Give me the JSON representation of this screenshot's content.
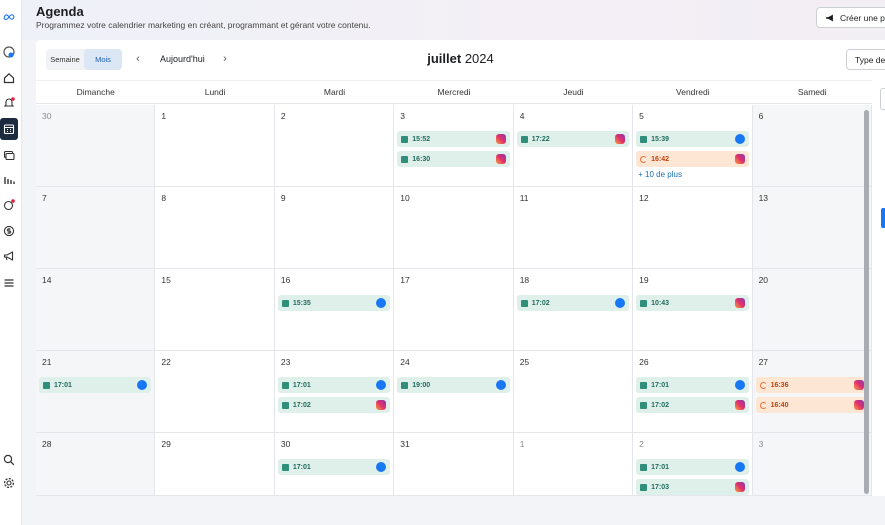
{
  "header": {
    "title": "Agenda",
    "subtitle": "Programmez votre calendrier marketing en créant, programmant et gérant votre contenu.",
    "create_button": "Créer une pu"
  },
  "toolbar": {
    "view_week": "Semaine",
    "view_month": "Mois",
    "today": "Aujourd'hui",
    "month": "juillet",
    "year": "2024",
    "type_button": "Type de"
  },
  "weekdays": [
    "Dimanche",
    "Lundi",
    "Mardi",
    "Mercredi",
    "Jeudi",
    "Vendredi",
    "Samedi"
  ],
  "weeks": [
    [
      {
        "day": "30",
        "muted": true,
        "events": []
      },
      {
        "day": "1",
        "events": []
      },
      {
        "day": "2",
        "events": []
      },
      {
        "day": "3",
        "events": [
          {
            "time": "15:52",
            "platform": "instagram"
          },
          {
            "time": "16:30",
            "platform": "instagram"
          }
        ]
      },
      {
        "day": "4",
        "events": [
          {
            "time": "17:22",
            "platform": "instagram"
          }
        ]
      },
      {
        "day": "5",
        "events": [
          {
            "time": "15:39",
            "platform": "facebook"
          },
          {
            "time": "16:42",
            "platform": "instagram",
            "pending": true
          }
        ],
        "more": "+ 10 de plus"
      },
      {
        "day": "6",
        "events": []
      }
    ],
    [
      {
        "day": "7",
        "events": []
      },
      {
        "day": "8",
        "events": []
      },
      {
        "day": "9",
        "events": []
      },
      {
        "day": "10",
        "events": []
      },
      {
        "day": "11",
        "events": []
      },
      {
        "day": "12",
        "events": []
      },
      {
        "day": "13",
        "events": []
      }
    ],
    [
      {
        "day": "14",
        "events": []
      },
      {
        "day": "15",
        "events": []
      },
      {
        "day": "16",
        "events": [
          {
            "time": "15:35",
            "platform": "facebook"
          }
        ]
      },
      {
        "day": "17",
        "events": []
      },
      {
        "day": "18",
        "events": [
          {
            "time": "17:02",
            "platform": "facebook"
          }
        ]
      },
      {
        "day": "19",
        "events": [
          {
            "time": "10:43",
            "platform": "instagram"
          }
        ]
      },
      {
        "day": "20",
        "events": []
      }
    ],
    [
      {
        "day": "21",
        "events": [
          {
            "time": "17:01",
            "platform": "facebook"
          }
        ]
      },
      {
        "day": "22",
        "events": []
      },
      {
        "day": "23",
        "events": [
          {
            "time": "17:01",
            "platform": "facebook"
          },
          {
            "time": "17:02",
            "platform": "instagram"
          }
        ]
      },
      {
        "day": "24",
        "events": [
          {
            "time": "19:00",
            "platform": "facebook"
          }
        ]
      },
      {
        "day": "25",
        "events": []
      },
      {
        "day": "26",
        "events": [
          {
            "time": "17:01",
            "platform": "facebook"
          },
          {
            "time": "17:02",
            "platform": "instagram"
          }
        ]
      },
      {
        "day": "27",
        "events": [
          {
            "time": "16:36",
            "platform": "instagram",
            "pending": true
          },
          {
            "time": "16:40",
            "platform": "instagram",
            "pending": true
          }
        ]
      }
    ],
    [
      {
        "day": "28",
        "events": []
      },
      {
        "day": "29",
        "events": []
      },
      {
        "day": "30",
        "events": [
          {
            "time": "17:01",
            "platform": "facebook"
          }
        ]
      },
      {
        "day": "31",
        "events": []
      },
      {
        "day": "1",
        "muted": true,
        "events": []
      },
      {
        "day": "2",
        "muted": true,
        "events": [
          {
            "time": "17:01",
            "platform": "facebook"
          },
          {
            "time": "17:03",
            "platform": "instagram"
          }
        ]
      },
      {
        "day": "3",
        "muted": true,
        "events": []
      }
    ]
  ],
  "rail_icons": [
    "meta-logo-icon",
    "profile-icon",
    "home-icon",
    "notifications-icon",
    "calendar-icon",
    "content-icon",
    "insights-icon",
    "ads-icon",
    "monetization-icon",
    "megaphone-icon",
    "menu-icon",
    "search-icon",
    "settings-icon"
  ]
}
